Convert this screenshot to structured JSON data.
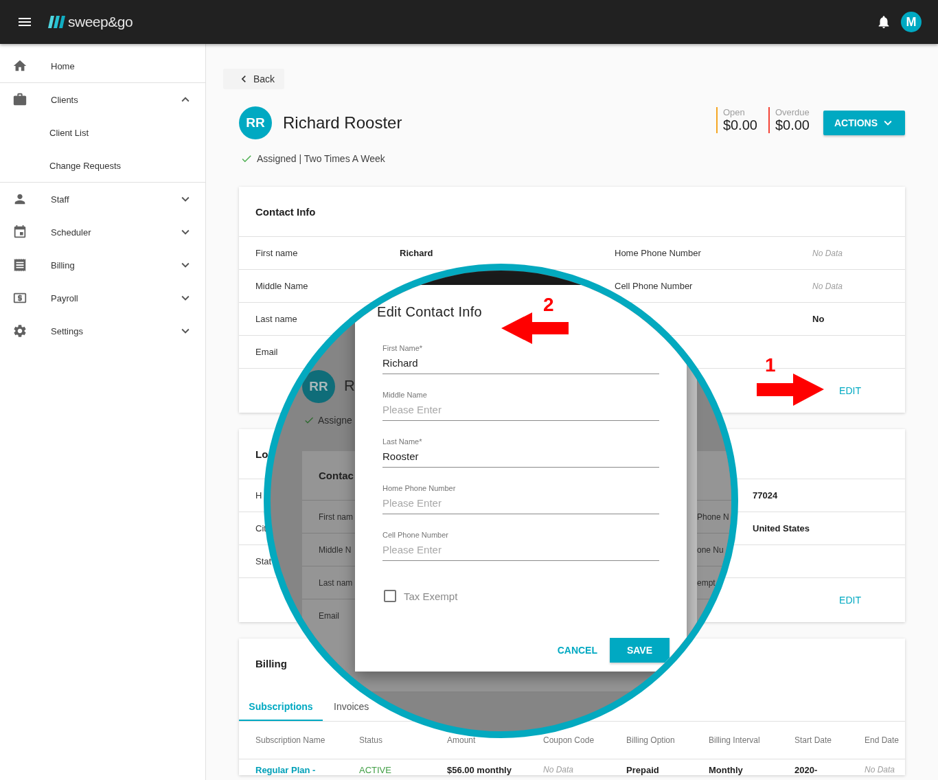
{
  "top_bar": {
    "logo_text": "sweep&go",
    "user_initial": "M"
  },
  "sidebar": {
    "items": [
      {
        "label": "Home"
      },
      {
        "label": "Clients",
        "expanded": true,
        "children": [
          {
            "label": "Client List"
          },
          {
            "label": "Change Requests"
          }
        ]
      },
      {
        "label": "Staff",
        "expanded": false
      },
      {
        "label": "Scheduler",
        "expanded": false
      },
      {
        "label": "Billing",
        "expanded": false
      },
      {
        "label": "Payroll",
        "expanded": false
      },
      {
        "label": "Settings",
        "expanded": false
      }
    ]
  },
  "back_button": "Back",
  "client": {
    "initials": "RR",
    "name": "Richard Rooster",
    "status": "Assigned | Two Times A Week"
  },
  "balances": [
    {
      "label": "Open",
      "amount": "$0.00",
      "color": "#f5a623"
    },
    {
      "label": "Overdue",
      "amount": "$0.00",
      "color": "#f44336"
    }
  ],
  "actions_button": "ACTIONS",
  "contact_card": {
    "title": "Contact Info",
    "edit": "EDIT",
    "rows": [
      [
        {
          "text": "First name",
          "kind": "label"
        },
        {
          "text": "Richard",
          "kind": "value"
        },
        {
          "text": "Home Phone Number",
          "kind": "label"
        },
        {
          "text": "No Data",
          "kind": "empty"
        }
      ],
      [
        {
          "text": "Middle Name",
          "kind": "label"
        },
        null,
        {
          "text": "Cell Phone Number",
          "kind": "label"
        },
        {
          "text": "No Data",
          "kind": "empty"
        }
      ],
      [
        {
          "text": "Last name",
          "kind": "label"
        },
        null,
        null,
        {
          "text": "No",
          "kind": "value"
        }
      ],
      [
        {
          "text": "Email",
          "kind": "label"
        },
        null,
        null,
        null
      ]
    ]
  },
  "location_card": {
    "title": "Lo",
    "edit": "EDIT",
    "rows": [
      [
        {
          "text": "H",
          "kind": "label"
        },
        null,
        null,
        {
          "text": "77024",
          "kind": "value"
        }
      ],
      [
        {
          "text": "Cit",
          "kind": "label"
        },
        null,
        null,
        {
          "text": "United States",
          "kind": "value"
        }
      ],
      [
        {
          "text": "Stat",
          "kind": "label"
        },
        null,
        null,
        null
      ]
    ]
  },
  "billing_card": {
    "title": "Billing",
    "tabs": [
      {
        "label": "Subscriptions",
        "selected": true
      },
      {
        "label": "Invoices",
        "selected": false
      }
    ],
    "columns": [
      "Subscription Name",
      "Status",
      "Amount",
      "Coupon Code",
      "Billing Option",
      "Billing Interval",
      "Start Date",
      "End Date"
    ],
    "rows": [
      [
        {
          "text": "Regular Plan -",
          "kind": "link"
        },
        {
          "text": "ACTIVE",
          "kind": "status"
        },
        {
          "text": "$56.00 monthly",
          "kind": "value"
        },
        {
          "text": "No Data",
          "kind": "empty"
        },
        {
          "text": "Prepaid",
          "kind": "value"
        },
        {
          "text": "Monthly",
          "kind": "value"
        },
        {
          "text": "2020-",
          "kind": "value"
        },
        {
          "text": "No Data",
          "kind": "empty"
        }
      ]
    ]
  },
  "magnifier": {
    "background": {
      "initials": "RR",
      "name": "R",
      "status": "Assigne",
      "card_title": "Contac",
      "labels": [
        "First nam",
        "Middle N",
        "Last nam",
        "Email"
      ],
      "right_labels": [
        "Phone N",
        "one Nu",
        "empt"
      ]
    },
    "dialog": {
      "title": "Edit Contact Info",
      "fields": [
        {
          "label": "First Name*",
          "value": "Richard"
        },
        {
          "label": "Middle Name",
          "placeholder": "Please Enter"
        },
        {
          "label": "Last Name*",
          "value": "Rooster"
        },
        {
          "label": "Home Phone Number",
          "placeholder": "Please Enter"
        },
        {
          "label": "Cell Phone Number",
          "placeholder": "Please Enter"
        }
      ],
      "checkbox": {
        "label": "Tax Exempt",
        "checked": false
      },
      "cancel": "CANCEL",
      "save": "SAVE"
    }
  },
  "annotations": [
    {
      "number": "1",
      "kind": "right"
    },
    {
      "number": "2",
      "kind": "left"
    }
  ]
}
